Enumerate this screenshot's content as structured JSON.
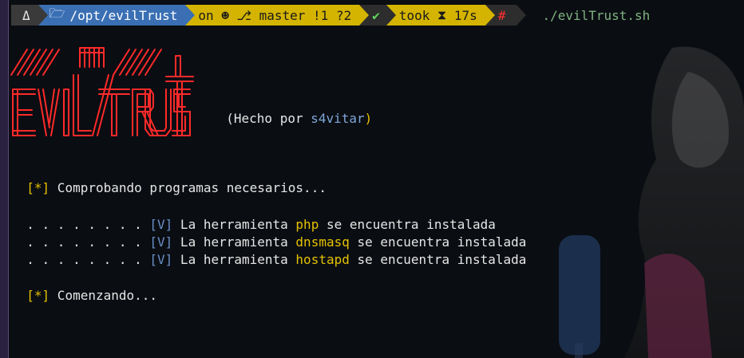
{
  "prompt": {
    "os_icon": "Δ",
    "dir_icon": "🗁",
    "path": "/opt/evilTrust",
    "git_on": "on",
    "git_icon": "⎇",
    "branch": "master",
    "changes": "!1 ?2",
    "ok_icon": "✔",
    "took_label": "took",
    "hourglass": "⧗",
    "took_value": "17s",
    "hash_icon": "#",
    "command": "./evilTrust.sh"
  },
  "banner": {
    "credit_prefix": "(Hecho por ",
    "credit_author": "s4vitar",
    "credit_suffix": ")"
  },
  "output": {
    "check_marker": "[*]",
    "check_text": " Comprobando programas necesarios...",
    "tools": [
      {
        "dots": ". . . . . . . . ",
        "marker": "[V]",
        "prefix": " La herramienta ",
        "name": "php",
        "suffix": " se encuentra instalada"
      },
      {
        "dots": ". . . . . . . . ",
        "marker": "[V]",
        "prefix": " La herramienta ",
        "name": "dnsmasq",
        "suffix": " se encuentra instalada"
      },
      {
        "dots": ". . . . . . . . ",
        "marker": "[V]",
        "prefix": " La herramienta ",
        "name": "hostapd",
        "suffix": " se encuentra instalada"
      }
    ],
    "start_marker": "[*]",
    "start_text": " Comenzando..."
  },
  "colors": {
    "accent_yellow": "#e6c200",
    "accent_blue": "#6a8fc8",
    "logo_red": "#ff2a2a",
    "ok_green": "#5fd75f"
  }
}
